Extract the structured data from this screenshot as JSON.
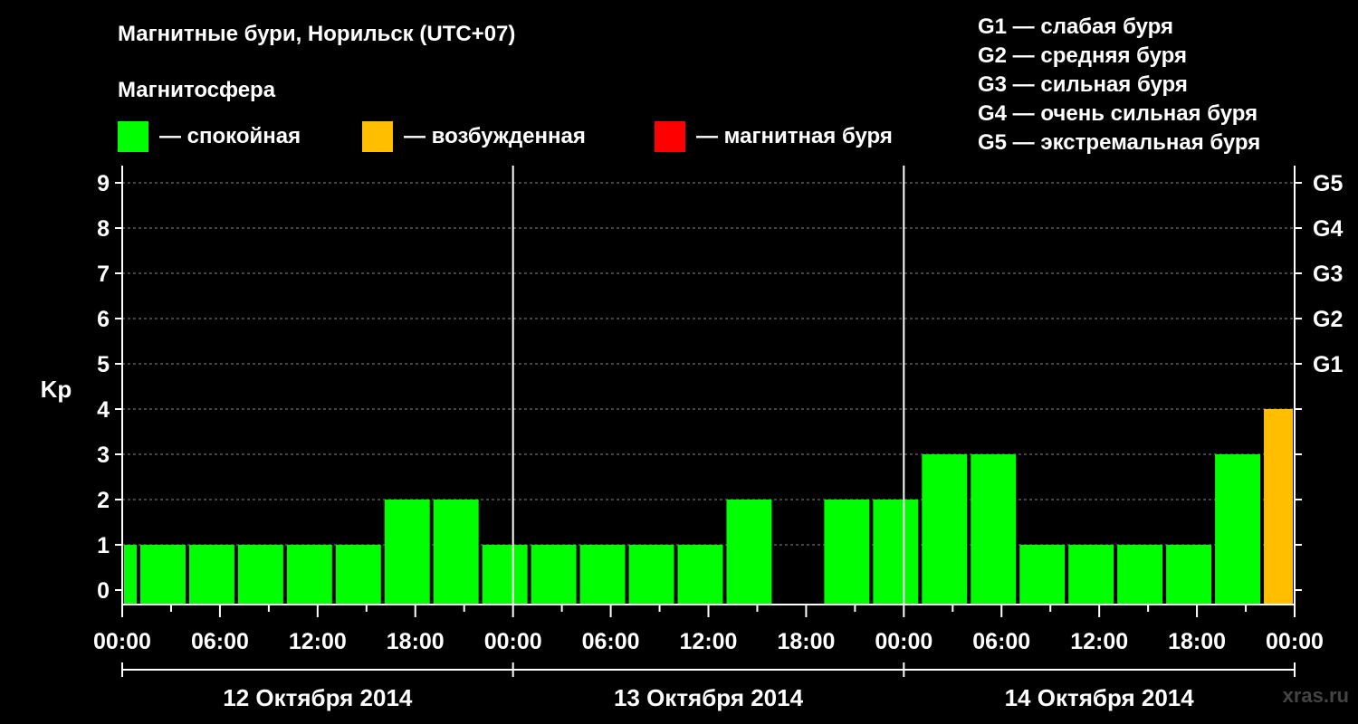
{
  "header": {
    "title": "Магнитные бури, Норильск (UTC+07)",
    "magnetosphere_label": "Магнитосфера"
  },
  "legend": [
    {
      "label": "— спокойная",
      "color": "#00ff00"
    },
    {
      "label": "— возбужденная",
      "color": "#ffbf00"
    },
    {
      "label": "— магнитная буря",
      "color": "#ff0000"
    }
  ],
  "g_levels": [
    "G1 — слабая буря",
    "G2 — средняя буря",
    "G3 — сильная буря",
    "G4 — очень сильная буря",
    "G5 — экстремальная буря"
  ],
  "watermark": "xras.ru",
  "chart_data": {
    "type": "bar",
    "ylabel": "Kp",
    "ylim": [
      0,
      9
    ],
    "yticks": [
      "0",
      "1",
      "2",
      "3",
      "4",
      "5",
      "6",
      "7",
      "8",
      "9"
    ],
    "right_ticks": [
      {
        "value": 5,
        "label": "G1"
      },
      {
        "value": 6,
        "label": "G2"
      },
      {
        "value": 7,
        "label": "G3"
      },
      {
        "value": 8,
        "label": "G4"
      },
      {
        "value": 9,
        "label": "G5"
      }
    ],
    "xlim_hours": [
      0,
      72
    ],
    "xticks": [
      "00:00",
      "06:00",
      "12:00",
      "18:00",
      "00:00",
      "06:00",
      "12:00",
      "18:00",
      "00:00",
      "06:00",
      "12:00",
      "18:00",
      "00:00"
    ],
    "days": [
      "12 Октября 2014",
      "13 Октября 2014",
      "14 Октября 2014"
    ],
    "grid": "dashed horizontal",
    "bars": [
      {
        "start": 0,
        "end": 1,
        "value": 1,
        "color": "#00ff00"
      },
      {
        "start": 1,
        "end": 4,
        "value": 1,
        "color": "#00ff00"
      },
      {
        "start": 4,
        "end": 7,
        "value": 1,
        "color": "#00ff00"
      },
      {
        "start": 7,
        "end": 10,
        "value": 1,
        "color": "#00ff00"
      },
      {
        "start": 10,
        "end": 13,
        "value": 1,
        "color": "#00ff00"
      },
      {
        "start": 13,
        "end": 16,
        "value": 1,
        "color": "#00ff00"
      },
      {
        "start": 16,
        "end": 19,
        "value": 2,
        "color": "#00ff00"
      },
      {
        "start": 19,
        "end": 22,
        "value": 2,
        "color": "#00ff00"
      },
      {
        "start": 22,
        "end": 25,
        "value": 1,
        "color": "#00ff00"
      },
      {
        "start": 25,
        "end": 28,
        "value": 1,
        "color": "#00ff00"
      },
      {
        "start": 28,
        "end": 31,
        "value": 1,
        "color": "#00ff00"
      },
      {
        "start": 31,
        "end": 34,
        "value": 1,
        "color": "#00ff00"
      },
      {
        "start": 34,
        "end": 37,
        "value": 1,
        "color": "#00ff00"
      },
      {
        "start": 37,
        "end": 40,
        "value": 2,
        "color": "#00ff00"
      },
      {
        "start": 43,
        "end": 46,
        "value": 2,
        "color": "#00ff00"
      },
      {
        "start": 46,
        "end": 49,
        "value": 2,
        "color": "#00ff00"
      },
      {
        "start": 49,
        "end": 52,
        "value": 3,
        "color": "#00ff00"
      },
      {
        "start": 52,
        "end": 55,
        "value": 3,
        "color": "#00ff00"
      },
      {
        "start": 55,
        "end": 58,
        "value": 1,
        "color": "#00ff00"
      },
      {
        "start": 58,
        "end": 61,
        "value": 1,
        "color": "#00ff00"
      },
      {
        "start": 61,
        "end": 64,
        "value": 1,
        "color": "#00ff00"
      },
      {
        "start": 64,
        "end": 67,
        "value": 1,
        "color": "#00ff00"
      },
      {
        "start": 67,
        "end": 70,
        "value": 3,
        "color": "#00ff00"
      },
      {
        "start": 70,
        "end": 72,
        "value": 4,
        "color": "#ffbf00"
      }
    ]
  }
}
